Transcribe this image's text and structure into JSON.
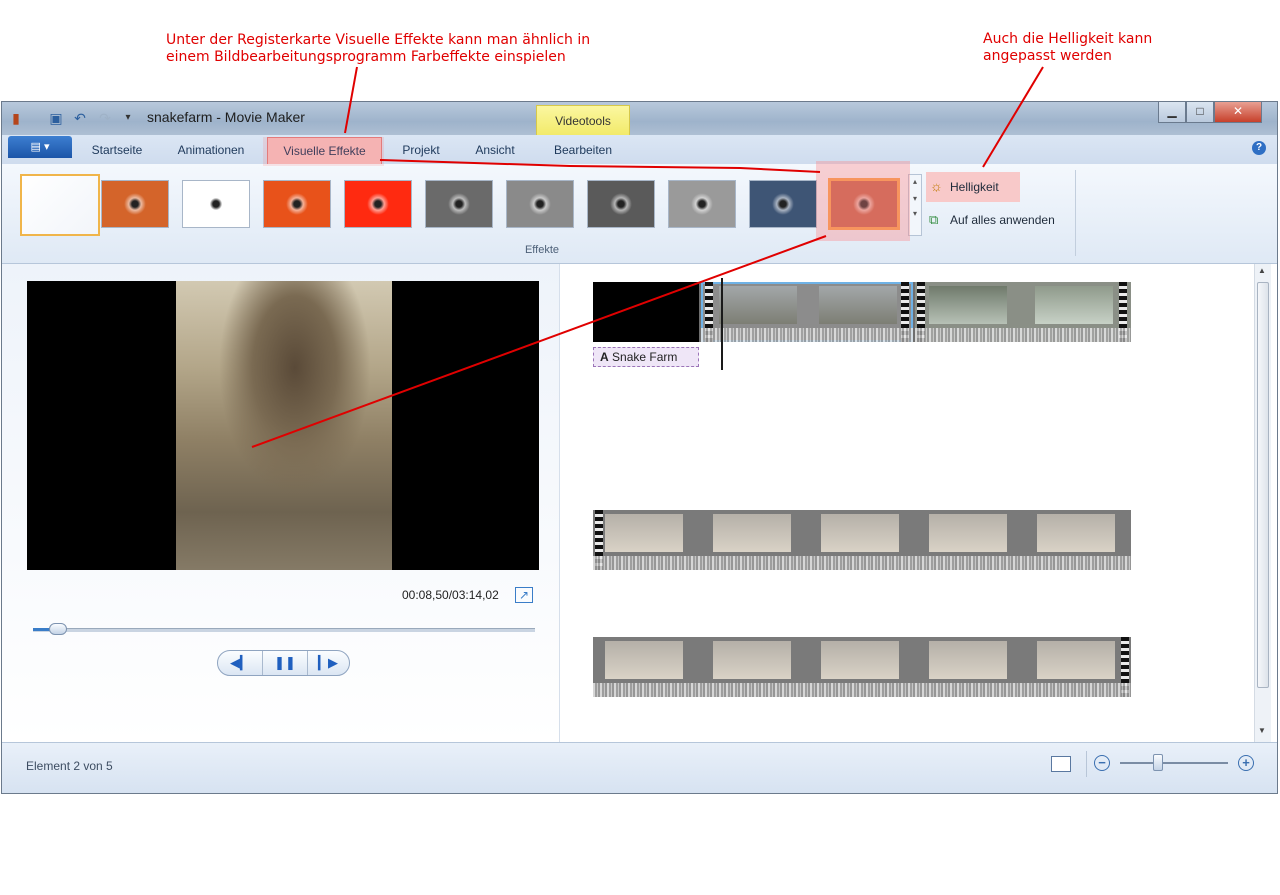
{
  "annotations": {
    "effects_note_line1": "Unter der Registerkarte Visuelle Effekte kann man ähnlich in",
    "effects_note_line2": "einem Bildbearbeitungsprogramm Farbeffekte einspielen",
    "brightness_note_line1": "Auch die Helligkeit kann",
    "brightness_note_line2": "angepasst werden",
    "color": "#e00000"
  },
  "window": {
    "title": "snakefarm - Movie Maker",
    "contextual_tab_group": "Videotools",
    "minimize_icon": "minimize-icon",
    "maximize_icon": "maximize-icon",
    "close_icon": "close-icon"
  },
  "tabs": [
    {
      "label": "Startseite"
    },
    {
      "label": "Animationen"
    },
    {
      "label": "Visuelle Effekte"
    },
    {
      "label": "Projekt"
    },
    {
      "label": "Ansicht"
    },
    {
      "label": "Bearbeiten"
    }
  ],
  "active_tab": "Visuelle Effekte",
  "ribbon": {
    "group_label": "Effekte",
    "brightness_label": "Helligkeit",
    "apply_all_label": "Auf alles anwenden",
    "effects": [
      {
        "name": "Kein Effekt",
        "color": "#f2f5fa"
      },
      {
        "name": "Weichzeichnen",
        "color": "#d4642a"
      },
      {
        "name": "Kantenerkennung",
        "color": "#ffffff"
      },
      {
        "name": "Sättigung",
        "color": "#e8521a"
      },
      {
        "name": "Hohe Sättigung",
        "color": "#ff2a10"
      },
      {
        "name": "Schwarzweiß",
        "color": "#6a6a6a"
      },
      {
        "name": "Schwarzweiß hell",
        "color": "#8a8a8a"
      },
      {
        "name": "Schwarzweiß dunkel",
        "color": "#5a5a5a"
      },
      {
        "name": "Schwarzweiß kontrast",
        "color": "#9a9a9a"
      },
      {
        "name": "Blau",
        "color": "#3e5575"
      },
      {
        "name": "Sepia",
        "color": "#c0624a"
      }
    ],
    "selected_effect": "Sepia"
  },
  "preview": {
    "timecode": "00:08,50/03:14,02",
    "seek_progress": 0.044
  },
  "storyboard": {
    "caption_label": "Snake Farm",
    "caption_icon": "A"
  },
  "status": {
    "text": "Element 2 von 5",
    "zoom_level": 0.35
  }
}
